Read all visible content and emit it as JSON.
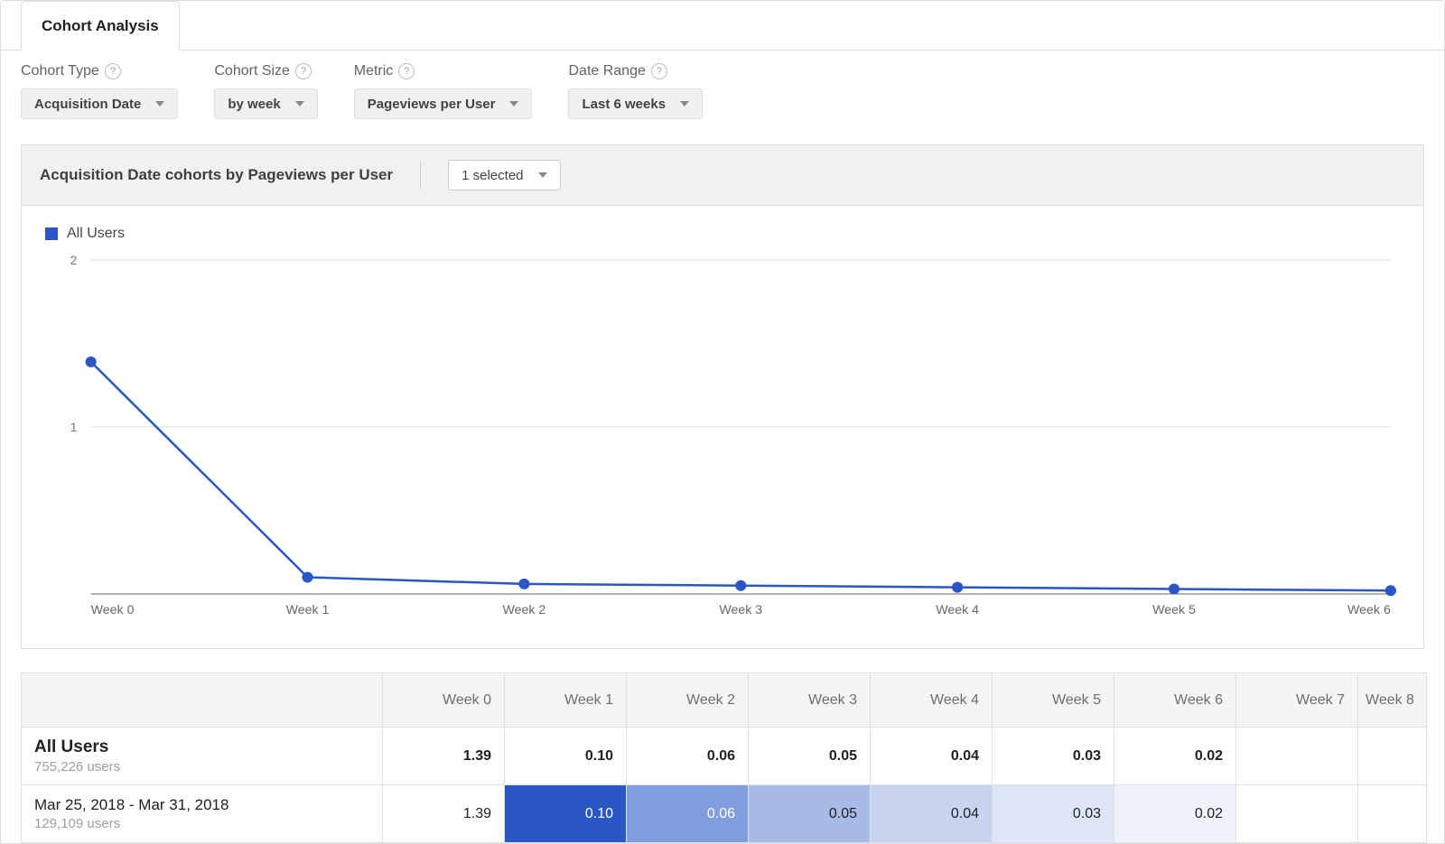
{
  "tab": {
    "active_label": "Cohort Analysis"
  },
  "controls": {
    "cohort_type": {
      "label": "Cohort Type",
      "value": "Acquisition Date"
    },
    "cohort_size": {
      "label": "Cohort Size",
      "value": "by week"
    },
    "metric": {
      "label": "Metric",
      "value": "Pageviews per User"
    },
    "date_range": {
      "label": "Date Range",
      "value": "Last 6 weeks"
    }
  },
  "chart_header": {
    "title": "Acquisition Date cohorts by Pageviews per User",
    "selector_value": "1 selected"
  },
  "legend": {
    "series_name": "All Users",
    "color": "#2a56c6"
  },
  "chart_data": {
    "type": "line",
    "title": "",
    "xlabel": "",
    "ylabel": "",
    "ylim": [
      0,
      2
    ],
    "y_ticks": [
      1,
      2
    ],
    "categories": [
      "Week 0",
      "Week 1",
      "Week 2",
      "Week 3",
      "Week 4",
      "Week 5",
      "Week 6"
    ],
    "series": [
      {
        "name": "All Users",
        "values": [
          1.39,
          0.1,
          0.06,
          0.05,
          0.04,
          0.03,
          0.02
        ]
      }
    ]
  },
  "table": {
    "columns": [
      "Week 0",
      "Week 1",
      "Week 2",
      "Week 3",
      "Week 4",
      "Week 5",
      "Week 6",
      "Week 7",
      "Week 8"
    ],
    "last_col_truncated_label": "Week 8",
    "rows": [
      {
        "label": "All Users",
        "sublabel": "755,226 users",
        "kind": "summary",
        "cells": [
          "1.39",
          "0.10",
          "0.06",
          "0.05",
          "0.04",
          "0.03",
          "0.02",
          "",
          ""
        ]
      },
      {
        "label": "Mar 25, 2018 - Mar 31, 2018",
        "sublabel": "129,109 users",
        "kind": "cohort",
        "cells": [
          "1.39",
          "0.10",
          "0.06",
          "0.05",
          "0.04",
          "0.03",
          "0.02",
          "",
          ""
        ],
        "heat": [
          "",
          "heat1",
          "heat2",
          "heat3",
          "heat4",
          "heat5",
          "heat6",
          "",
          ""
        ]
      }
    ]
  }
}
